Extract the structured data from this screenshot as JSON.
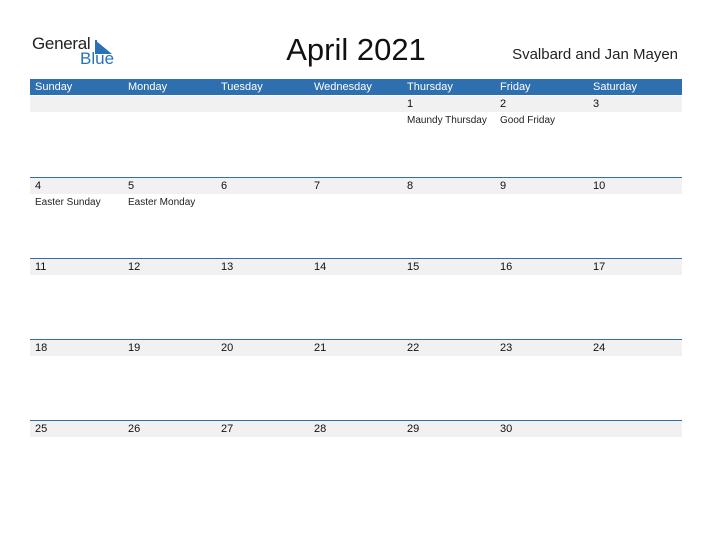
{
  "logo": {
    "general": "General",
    "blue": "Blue",
    "icon": "triangle-flag-icon"
  },
  "title": "April 2021",
  "region": "Svalbard and Jan Mayen",
  "colors": {
    "header": "#2e6faf",
    "strip": "#f1f1f1",
    "brand_blue": "#2a72b8"
  },
  "weekdays": [
    "Sunday",
    "Monday",
    "Tuesday",
    "Wednesday",
    "Thursday",
    "Friday",
    "Saturday"
  ],
  "weeks": [
    [
      {
        "day": ""
      },
      {
        "day": ""
      },
      {
        "day": ""
      },
      {
        "day": ""
      },
      {
        "day": "1",
        "holiday": "Maundy Thursday"
      },
      {
        "day": "2",
        "holiday": "Good Friday"
      },
      {
        "day": "3"
      }
    ],
    [
      {
        "day": "4",
        "holiday": "Easter Sunday"
      },
      {
        "day": "5",
        "holiday": "Easter Monday"
      },
      {
        "day": "6"
      },
      {
        "day": "7"
      },
      {
        "day": "8"
      },
      {
        "day": "9"
      },
      {
        "day": "10"
      }
    ],
    [
      {
        "day": "11"
      },
      {
        "day": "12"
      },
      {
        "day": "13"
      },
      {
        "day": "14"
      },
      {
        "day": "15"
      },
      {
        "day": "16"
      },
      {
        "day": "17"
      }
    ],
    [
      {
        "day": "18"
      },
      {
        "day": "19"
      },
      {
        "day": "20"
      },
      {
        "day": "21"
      },
      {
        "day": "22"
      },
      {
        "day": "23"
      },
      {
        "day": "24"
      }
    ],
    [
      {
        "day": "25"
      },
      {
        "day": "26"
      },
      {
        "day": "27"
      },
      {
        "day": "28"
      },
      {
        "day": "29"
      },
      {
        "day": "30"
      },
      {
        "day": ""
      }
    ]
  ]
}
